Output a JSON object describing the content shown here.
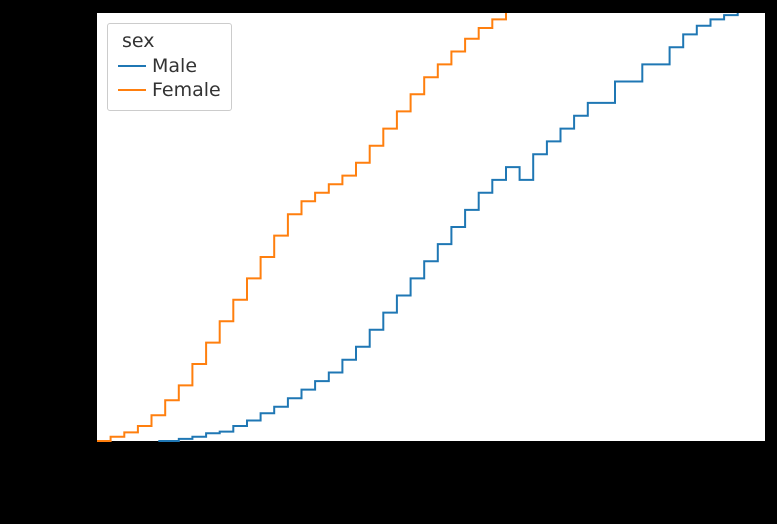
{
  "chart_data": {
    "type": "line",
    "title": "",
    "xlabel": "",
    "ylabel": "",
    "xlim": [
      8,
      57
    ],
    "ylim": [
      0.0,
      1.0
    ],
    "legend_title": "sex",
    "legend_position": "upper left",
    "grid": false,
    "series": [
      {
        "name": "Male",
        "color": "#1f77b4",
        "x": [
          12.5,
          14,
          15,
          16,
          17,
          18,
          19,
          20,
          21,
          22,
          23,
          24,
          25,
          26,
          27,
          28,
          29,
          30,
          31,
          32,
          33,
          34,
          35,
          36,
          37,
          38,
          39,
          40,
          41,
          42,
          43,
          44,
          46,
          48,
          50,
          51,
          52,
          53,
          54,
          55
        ],
        "values": [
          0.0,
          0.005,
          0.01,
          0.018,
          0.022,
          0.035,
          0.048,
          0.065,
          0.08,
          0.1,
          0.12,
          0.14,
          0.16,
          0.19,
          0.22,
          0.26,
          0.3,
          0.34,
          0.38,
          0.42,
          0.46,
          0.5,
          0.54,
          0.58,
          0.61,
          0.64,
          0.61,
          0.67,
          0.7,
          0.73,
          0.76,
          0.79,
          0.84,
          0.88,
          0.92,
          0.95,
          0.97,
          0.985,
          0.995,
          1.0
        ]
      },
      {
        "name": "Female",
        "color": "#ff7f0e",
        "x": [
          8,
          9,
          10,
          11,
          12,
          13,
          14,
          15,
          16,
          17,
          18,
          19,
          20,
          21,
          22,
          23,
          24,
          25,
          26,
          27,
          28,
          29,
          30,
          31,
          32,
          33,
          34,
          35,
          36,
          37,
          38
        ],
        "values": [
          0.0,
          0.01,
          0.02,
          0.035,
          0.06,
          0.095,
          0.13,
          0.18,
          0.23,
          0.28,
          0.33,
          0.38,
          0.43,
          0.48,
          0.53,
          0.56,
          0.58,
          0.6,
          0.62,
          0.65,
          0.69,
          0.73,
          0.77,
          0.81,
          0.85,
          0.88,
          0.91,
          0.94,
          0.965,
          0.985,
          1.0
        ]
      }
    ]
  }
}
